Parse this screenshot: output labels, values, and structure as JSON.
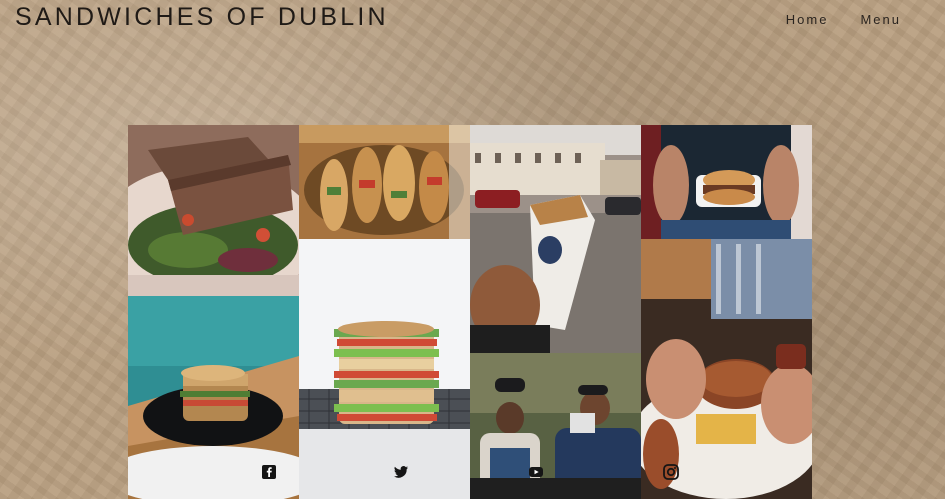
{
  "site": {
    "title": "SANDWICHES OF DUBLIN"
  },
  "nav": {
    "items": [
      "Home",
      "Menu"
    ]
  },
  "gallery": {
    "photos": [
      "toasted-brown-bread-sandwich",
      "baguette-sandwich-basket",
      "street-wrap-in-hand",
      "person-holding-sandwich",
      "stacked-sandwich-on-plate",
      "club-sandwich-stack",
      "friends-eating-outdoors",
      "hands-tearing-burger"
    ]
  },
  "social": {
    "icons": [
      "facebook-icon",
      "twitter-icon",
      "youtube-icon",
      "instagram-icon"
    ]
  }
}
